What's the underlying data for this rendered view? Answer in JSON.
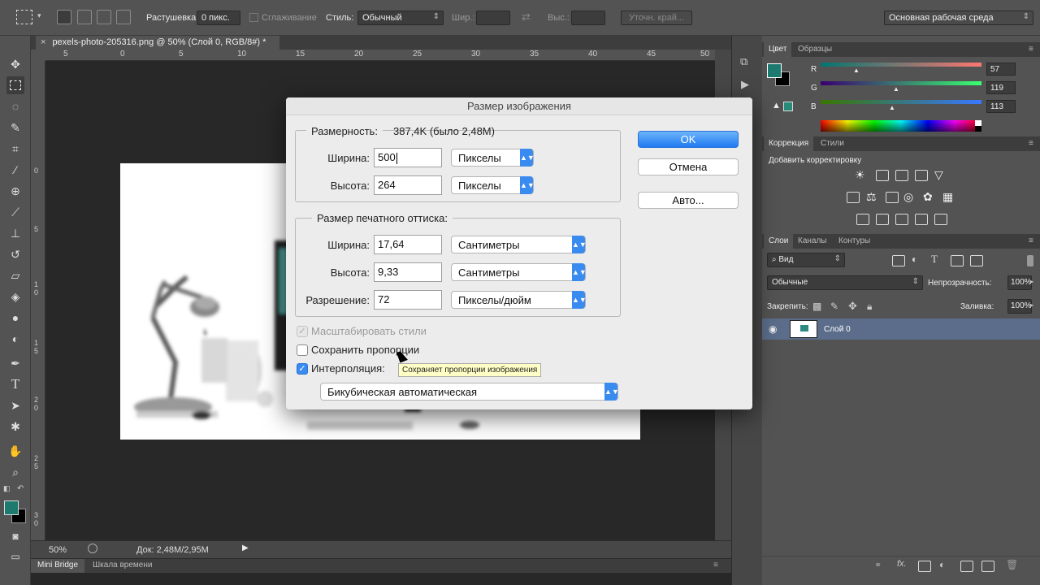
{
  "options_bar": {
    "feather_label": "Растушевка:",
    "feather_value": "0 пикс.",
    "antialias_label": "Сглаживание",
    "style_label": "Стиль:",
    "style_value": "Обычный",
    "width_label": "Шир.:",
    "height_label": "Выс.:",
    "refine_edge": "Уточн. край...",
    "workspace": "Основная рабочая среда"
  },
  "document": {
    "tab_title": "pexels-photo-205316.png @ 50% (Слой 0, RGB/8#) *",
    "ruler_h": [
      "5",
      "0",
      "5",
      "10",
      "15",
      "20",
      "25",
      "30",
      "35",
      "40",
      "45",
      "50"
    ],
    "ruler_v": [
      "0",
      "5",
      "1\n0",
      "1\n5",
      "2\n0",
      "2\n5",
      "3\n0"
    ],
    "zoom": "50%",
    "doc_info": "Док: 2,48M/2,95M"
  },
  "bottom_tabs": [
    "Mini Bridge",
    "Шкала времени"
  ],
  "color_panel": {
    "tabs": [
      "Цвет",
      "Образцы"
    ],
    "r_label": "R",
    "r_value": "57",
    "g_label": "G",
    "g_value": "119",
    "b_label": "B",
    "b_value": "113",
    "foreground_color": "#397771"
  },
  "adjustments_panel": {
    "tabs": [
      "Коррекция",
      "Стили"
    ],
    "heading": "Добавить корректировку"
  },
  "layers_panel": {
    "tabs": [
      "Слои",
      "Каналы",
      "Контуры"
    ],
    "filter_kind": "Вид",
    "blend_mode": "Обычные",
    "opacity_label": "Непрозрачность:",
    "opacity_value": "100%",
    "lock_label": "Закрепить:",
    "fill_label": "Заливка:",
    "fill_value": "100%",
    "layers": [
      {
        "name": "Слой 0"
      }
    ]
  },
  "dialog": {
    "title": "Размер изображения",
    "pixel_dims_label": "Размерность:",
    "pixel_dims_value": "387,4K (было 2,48M)",
    "width_label": "Ширина:",
    "width_value": "500",
    "width_unit": "Пикселы",
    "height_label": "Высота:",
    "height_value": "264",
    "height_unit": "Пикселы",
    "print_group": "Размер печатного оттиска:",
    "print_width_label": "Ширина:",
    "print_width_value": "17,64",
    "print_width_unit": "Сантиметры",
    "print_height_label": "Высота:",
    "print_height_value": "9,33",
    "print_height_unit": "Сантиметры",
    "resolution_label": "Разрешение:",
    "resolution_value": "72",
    "resolution_unit": "Пикселы/дюйм",
    "scale_styles": "Масштабировать стили",
    "constrain": "Сохранить пропорции",
    "resample": "Интерполяция:",
    "resample_method": "Бикубическая автоматическая",
    "ok": "OK",
    "cancel": "Отмена",
    "auto": "Авто..."
  },
  "tooltip": "Сохраняет пропорции изображения"
}
